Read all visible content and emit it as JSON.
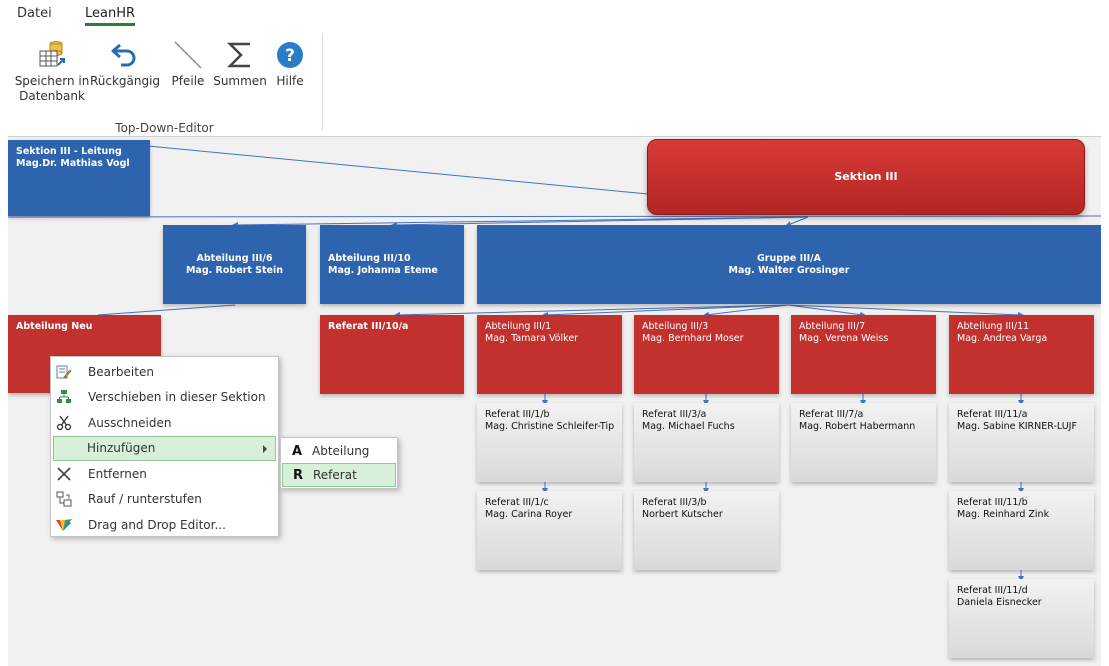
{
  "ribbon": {
    "tabs": [
      {
        "label": "Datei"
      },
      {
        "label": "LeanHR"
      }
    ],
    "buttons": [
      {
        "label": "Speichern in Datenbank",
        "label1": "Speichern in",
        "label2": "Datenbank",
        "icon": "database-save-icon"
      },
      {
        "label": "Rückgängig",
        "icon": "undo-icon"
      },
      {
        "label": "Pfeile",
        "icon": "arrow-line-icon"
      },
      {
        "label": "Summen",
        "icon": "sigma-icon"
      },
      {
        "label": "Hilfe",
        "icon": "help-icon"
      }
    ],
    "group_label": "Top-Down-Editor"
  },
  "org": {
    "leitung": {
      "title": "Sektion III - Leitung",
      "person": "Mag.Dr. Mathias Vogl"
    },
    "sektion": {
      "title": "Sektion III"
    },
    "abteilung_6": {
      "title": "Abteilung III/6",
      "person": "Mag. Robert Stein"
    },
    "abteilung_10": {
      "title": "Abteilung III/10",
      "person": "Mag. Johanna Eteme"
    },
    "gruppe_a": {
      "title": "Gruppe III/A",
      "person": "Mag. Walter Grosinger"
    },
    "abteilung_neu": {
      "title": "Abteilung Neu"
    },
    "referat_10a": {
      "title": "Referat III/10/a"
    },
    "abteilung_1": {
      "title": "Abteilung III/1",
      "person": "Mag. Tamara Völker"
    },
    "abteilung_3": {
      "title": "Abteilung III/3",
      "person": "Mag. Bernhard Moser"
    },
    "abteilung_7": {
      "title": "Abteilung III/7",
      "person": "Mag. Verena Weiss"
    },
    "abteilung_11": {
      "title": "Abteilung III/11",
      "person": "Mag. Andrea Varga"
    },
    "referat_1b": {
      "title": "Referat III/1/b",
      "person": "Mag. Christine Schleifer-Tipp"
    },
    "referat_1c": {
      "title": "Referat III/1/c",
      "person": "Mag. Carina Royer"
    },
    "referat_3a": {
      "title": "Referat III/3/a",
      "person": "Mag. Michael Fuchs"
    },
    "referat_3b": {
      "title": "Referat III/3/b",
      "person": "Norbert Kutscher"
    },
    "referat_7a": {
      "title": "Referat III/7/a",
      "person": "Mag. Robert Habermann"
    },
    "referat_11a": {
      "title": "Referat III/11/a",
      "person": "Mag. Sabine KIRNER-LUJF"
    },
    "referat_11b": {
      "title": "Referat III/11/b",
      "person": "Mag. Reinhard Zink"
    },
    "referat_11d": {
      "title": "Referat III/11/d",
      "person": "Daniela Eisnecker"
    }
  },
  "context_menu": {
    "items": [
      {
        "label": "Bearbeiten",
        "icon": "edit-icon"
      },
      {
        "label": "Verschieben in dieser Sektion",
        "icon": "move-tree-icon"
      },
      {
        "label": "Ausschneiden",
        "icon": "scissors-icon"
      },
      {
        "label": "Hinzufügen",
        "icon": "",
        "highlighted": true
      },
      {
        "label": "Entfernen",
        "icon": "remove-x-icon"
      },
      {
        "label": "Rauf / runterstufen",
        "icon": "hierarchy-icon"
      },
      {
        "label": "Drag and Drop Editor...",
        "icon": "drag-drop-logo-icon"
      }
    ]
  },
  "submenu": {
    "items": [
      {
        "key": "A",
        "label": "Abteilung"
      },
      {
        "key": "R",
        "label": "Referat",
        "highlighted": true
      }
    ]
  },
  "colors": {
    "blue": "#2e64ad",
    "red": "#c3312e",
    "grey": "#d9d9d9",
    "accent_green": "#2e7d32",
    "menu_highlight": "#d8efd9"
  }
}
